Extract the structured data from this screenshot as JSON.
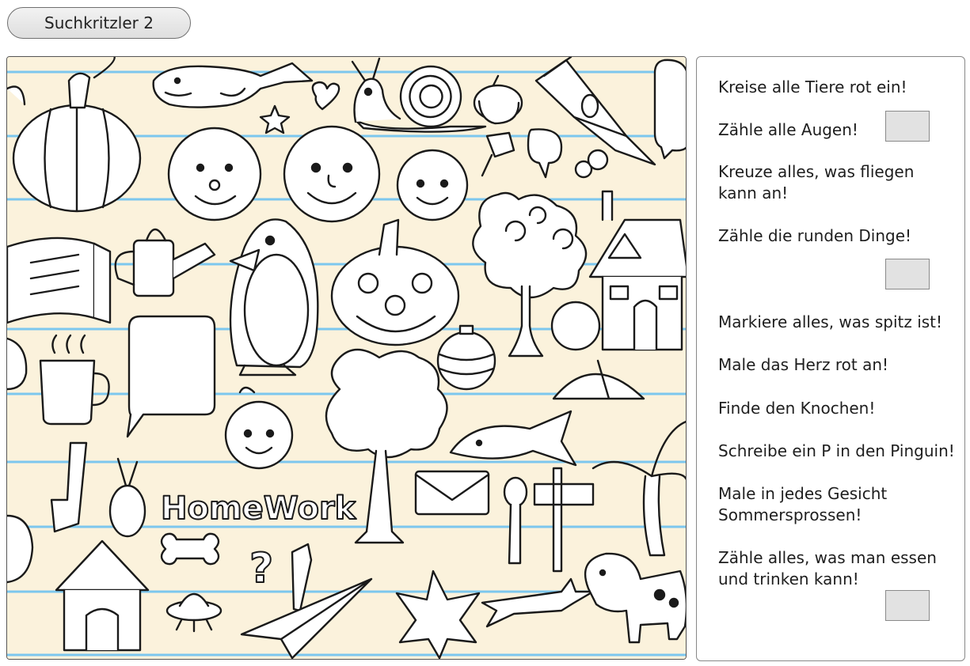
{
  "worksheet": {
    "title": "Suchkritzler 2",
    "picture": {
      "background_color": "#fbf2dc",
      "line_color": "#7cc7ee",
      "doodle_word": "HomeWork"
    },
    "tasks": [
      {
        "text": "Kreise alle Tiere rot ein!"
      },
      {
        "text": "Zähle alle Augen!"
      },
      {
        "text": "Kreuze alles, was fliegen\nkann an!"
      },
      {
        "text": "Zähle die runden Dinge!"
      },
      {
        "text": "Markiere alles, was spitz ist!"
      },
      {
        "text": "Male das Herz rot an!"
      },
      {
        "text": "Finde den Knochen!"
      },
      {
        "text": "Schreibe ein P in den Pinguin!"
      },
      {
        "text": "Male in jedes Gesicht\nSommersprossen!"
      },
      {
        "text": "Zähle alles, was man essen\nund trinken kann!"
      }
    ]
  }
}
